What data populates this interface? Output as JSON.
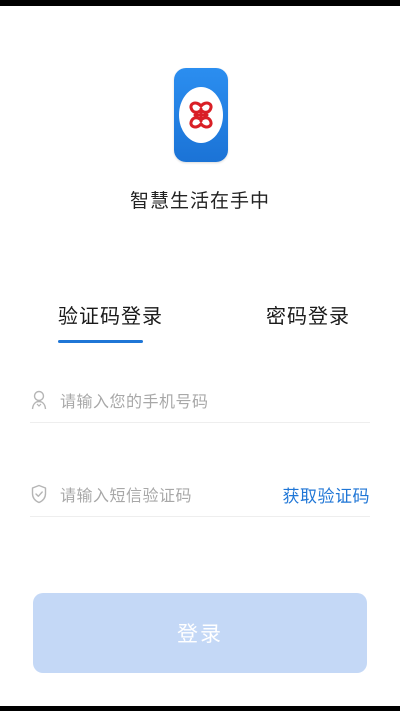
{
  "app": {
    "tagline": "智慧生活在手中",
    "logo_icon": "china-unicom-knot-icon",
    "colors": {
      "accent": "#1f76d6",
      "logo_blue": "#1b73d6",
      "logo_knot_red": "#d91f26",
      "button_disabled": "#c4d8f6",
      "placeholder": "#a8a8a8"
    }
  },
  "tabs": [
    {
      "label": "验证码登录",
      "active": true
    },
    {
      "label": "密码登录",
      "active": false
    }
  ],
  "form": {
    "phone": {
      "icon": "user-icon",
      "placeholder": "请输入您的手机号码"
    },
    "code": {
      "icon": "shield-check-icon",
      "placeholder": "请输入短信验证码",
      "get_code_label": "获取验证码"
    },
    "login_label": "登录"
  }
}
